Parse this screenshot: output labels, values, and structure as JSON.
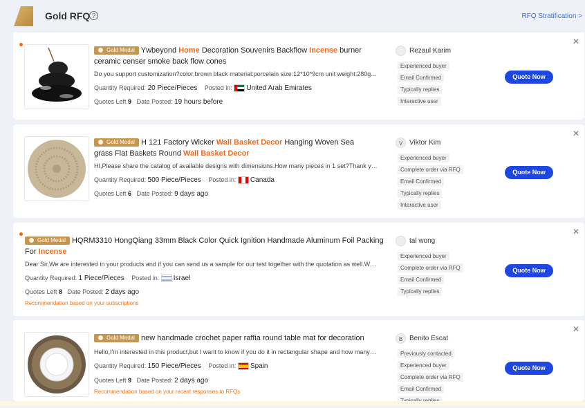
{
  "header": {
    "title": "Gold RFQ",
    "help": "?",
    "stratification": "RFQ Stratification >"
  },
  "badge_label": "Gold Medal",
  "quote_label": "Quote Now",
  "labels": {
    "qty": "Quantity Required:",
    "posted": "Posted in:",
    "quotes_left": "Quotes Left",
    "date_posted": "Date Posted:"
  },
  "cards": [
    {
      "title_parts": [
        "Ywbeyond ",
        "Home",
        " Decoration Souvenirs Backflow ",
        "Incense",
        " burner ceramic censer smoke back flow cones"
      ],
      "desc": "Do you support customization?color:brown black material:porcelain size:12*10*9cm unit weight:280g p...",
      "qty": "20 Piece/Pieces",
      "country": "United Arab Emirates",
      "quotes": "9",
      "date": "19 hours before",
      "buyer": "Rezaul Karim",
      "avatar": "",
      "tags": [
        "Experienced buyer",
        "Email Confirmed",
        "Typically replies",
        "Interactive user"
      ]
    },
    {
      "title_parts": [
        "H 121 Factory Wicker ",
        "Wall Basket Decor",
        " Hanging Woven Sea grass Flat Baskets Round ",
        "Wall Basket Decor",
        ""
      ],
      "desc": "HI,Please share the catalog of available designs with dimensions.How many pieces in 1 set?Thank you. ...",
      "qty": "500 Piece/Pieces",
      "country": "Canada",
      "quotes": "6",
      "date": "9 days ago",
      "buyer": "Viktor Kim",
      "avatar": "V",
      "tags": [
        "Experienced buyer",
        "Complete order via RFQ",
        "Email Confirmed",
        "Typically replies",
        "Interactive user"
      ]
    },
    {
      "title_parts": [
        "HQRM3310 HongQiang 33mm Black Color Quick Ignition Handmade Aluminum Foil Packing For ",
        "Incense",
        "",
        "",
        ""
      ],
      "desc": "Dear Sir,We are interested in your products and if you can send us a sample for our test together with the quotation as well.What i...",
      "qty": "1 Piece/Pieces",
      "country": "Israel",
      "quotes": "8",
      "date": "2 days ago",
      "recommend": "Recommendation based on your subscriptions",
      "buyer": "tal wong",
      "avatar": "",
      "tags": [
        "Experienced buyer",
        "Complete order via RFQ",
        "Email Confirmed",
        "Typically replies"
      ]
    },
    {
      "title_parts": [
        "new handmade crochet paper raffia round table mat for decoration",
        "",
        "",
        "",
        ""
      ],
      "desc": "Hello,I'm interested in this product,but I want to know if you do it in rectangular shape and how many col...",
      "qty": "150 Piece/Pieces",
      "country": "Spain",
      "quotes": "9",
      "date": "2 days ago",
      "recommend": "Recommendation based on your recent responses to RFQs",
      "buyer": "Benito Escat",
      "avatar": "B",
      "tags": [
        "Previously contacted",
        "Experienced buyer",
        "Complete order via RFQ",
        "Email Confirmed",
        "Typically replies"
      ]
    }
  ],
  "colors": {
    "accent": "#f06a1b",
    "button": "#1e46e0",
    "gold": "#c49650",
    "link": "#3d6fd8"
  },
  "icons": {
    "close": "close-icon",
    "help": "help-icon"
  }
}
